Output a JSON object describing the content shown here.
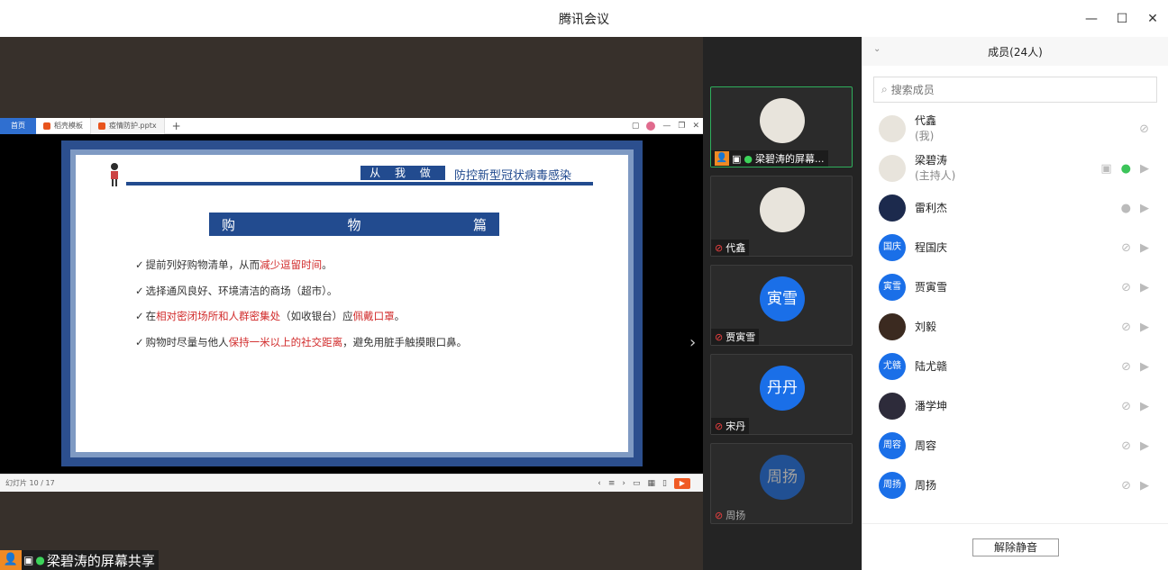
{
  "app": {
    "title": "腾讯会议"
  },
  "window_controls": {
    "minimize": "—",
    "maximize": "☐",
    "close": "✕"
  },
  "ppt": {
    "tabs": [
      {
        "label": "首页",
        "type": "home"
      },
      {
        "label": "稻壳模板"
      },
      {
        "label": "疫情防护.pptx",
        "active": true
      }
    ],
    "status": "幻灯片 10 / 17",
    "slide": {
      "pill": "从 我 做 起",
      "headline": "防控新型冠状病毒感染",
      "section": [
        "购",
        "物",
        "篇"
      ],
      "bullets": [
        {
          "parts": [
            {
              "t": "提前列好购物清单，从而"
            },
            {
              "t": "减少逗留时间",
              "hl": true
            },
            {
              "t": "。"
            }
          ]
        },
        {
          "parts": [
            {
              "t": "选择通风良好、环境清洁的商场（超市）。"
            }
          ]
        },
        {
          "parts": [
            {
              "t": "在"
            },
            {
              "t": "相对密闭场所和人群密集处",
              "hl": true
            },
            {
              "t": "（如收银台）应"
            },
            {
              "t": "佩戴口罩",
              "hl": true
            },
            {
              "t": "。"
            }
          ]
        },
        {
          "parts": [
            {
              "t": "购物时尽量与他人"
            },
            {
              "t": "保持一米以上的社交距离",
              "hl": true
            },
            {
              "t": "，避免用脏手触摸眼口鼻。"
            }
          ]
        }
      ]
    }
  },
  "sharer_label": "梁碧涛的屏幕共享",
  "tiles": [
    {
      "name": "梁碧涛的屏幕...",
      "avatar": "",
      "pic": true,
      "active": true,
      "sharing": true
    },
    {
      "name": "代鑫",
      "avatar": "",
      "pic": true,
      "muted": true
    },
    {
      "name": "贾寅雪",
      "avatar": "寅雪",
      "muted": true
    },
    {
      "name": "宋丹",
      "avatar": "丹丹",
      "muted": true
    },
    {
      "name": "周扬",
      "avatar": "周扬",
      "muted": true,
      "dim": true
    }
  ],
  "panel": {
    "title": "成员(24人)",
    "search_placeholder": "搜索成员",
    "unmute_all": "解除静音",
    "members": [
      {
        "name": "代鑫",
        "sub": "(我)",
        "avatar": "",
        "kind": "pic",
        "icons": "me"
      },
      {
        "name": "梁碧涛",
        "sub": "(主持人)",
        "avatar": "",
        "kind": "pic",
        "icons": "host"
      },
      {
        "name": "雷利杰",
        "avatar": "",
        "kind": "dark",
        "icons": "mic"
      },
      {
        "name": "程国庆",
        "avatar": "国庆",
        "icons": "muted"
      },
      {
        "name": "贾寅雪",
        "avatar": "寅雪",
        "icons": "muted"
      },
      {
        "name": "刘毅",
        "avatar": "",
        "kind": "brown",
        "icons": "muted"
      },
      {
        "name": "陆尤赣",
        "avatar": "尤赣",
        "icons": "muted"
      },
      {
        "name": "潘学坤",
        "avatar": "",
        "kind": "anime",
        "icons": "muted"
      },
      {
        "name": "周容",
        "avatar": "周容",
        "icons": "muted"
      },
      {
        "name": "周扬",
        "avatar": "周扬",
        "icons": "muted"
      }
    ]
  }
}
